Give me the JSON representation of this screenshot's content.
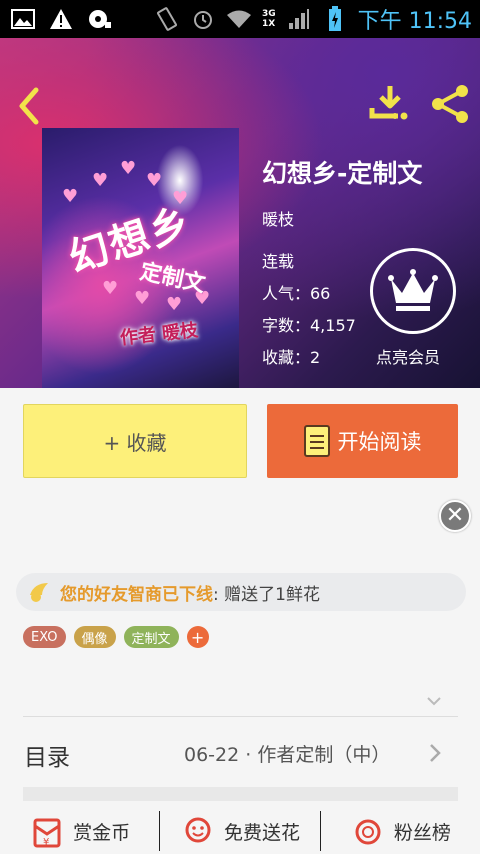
{
  "status_bar": {
    "time": "下午 11:54",
    "network_top": "3G",
    "network_bottom": "1X"
  },
  "header": {
    "back_icon": "chevron-left-icon",
    "download_icon": "download-icon",
    "share_icon": "share-icon"
  },
  "cover": {
    "title_art": "幻想乡",
    "subtitle_art": "定制文",
    "author_art": "作者 暖枝"
  },
  "book": {
    "title": "幻想乡-定制文",
    "author": "暖枝",
    "status": "连载",
    "popularity": "人气：66",
    "word_count": "字数：4,157",
    "favorites": "收藏：2"
  },
  "vip": {
    "label": "点亮会员",
    "icon": "crown-icon"
  },
  "actions": {
    "collect_label": "+ 收藏",
    "read_label": "开始阅读"
  },
  "notice": {
    "highlight": "您的好友智商已下线",
    "rest": ": 赠送了1鲜花"
  },
  "tags": [
    {
      "label": "EXO",
      "color": "#c8705f"
    },
    {
      "label": "偶像",
      "color": "#c9a24a"
    },
    {
      "label": "定制文",
      "color": "#8fb35a"
    }
  ],
  "toc": {
    "label": "目录",
    "latest": "06-22 · 作者定制（中）"
  },
  "bottom_bar": {
    "reward": "赏金币",
    "flowers": "免费送花",
    "fans": "粉丝榜"
  },
  "colors": {
    "accent_orange": "#ec6a3a",
    "collect_yellow": "#fdf07a",
    "icon_yellow": "#f2e24a",
    "notice_orange": "#e59a2c"
  }
}
